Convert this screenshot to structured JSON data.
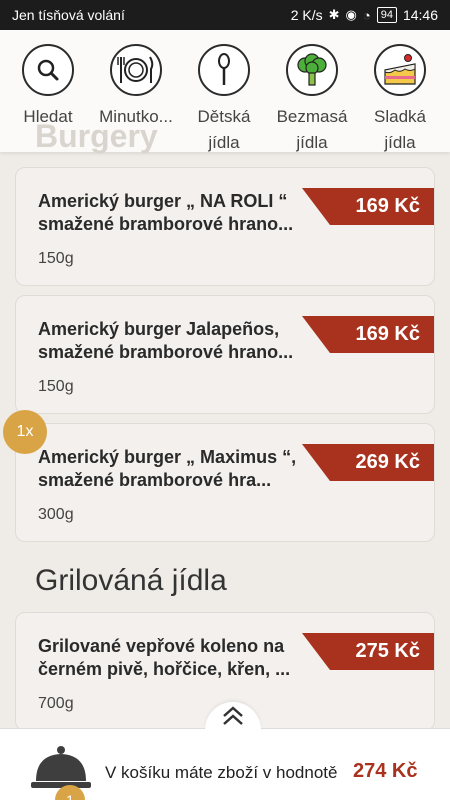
{
  "status_bar": {
    "carrier": "Jen tísňová volání",
    "speed": "2 K/s",
    "battery": "94",
    "time": "14:46"
  },
  "ghost_title": "Burgery",
  "categories": [
    {
      "label": "Hledat",
      "icon": "search-icon"
    },
    {
      "label": "Minutko...",
      "icon": "plate-cutlery-icon"
    },
    {
      "label": "Dětská\njídla",
      "icon": "spoon-icon"
    },
    {
      "label": "Bezmasá\njídla",
      "icon": "broccoli-icon"
    },
    {
      "label": "Sladká\njídla",
      "icon": "cake-icon"
    }
  ],
  "items": [
    {
      "name": "Americký burger „ NA ROLI “ smažené bramborové hrano...",
      "weight": "150g",
      "price": "169 Kč"
    },
    {
      "name": "Americký burger Jalapeños, smažené bramborové hrano...",
      "weight": "150g",
      "price": "169 Kč"
    },
    {
      "name": "Americký burger „ Maximus “, smažené bramborové hra...",
      "weight": "300g",
      "price": "269 Kč",
      "quantity": "1x"
    },
    {
      "name": "Grilované vepřové koleno na černém pivě, hořčice, křen, ...",
      "weight": "700g",
      "price": "275 Kč"
    }
  ],
  "section_grill": "Grilováná jídla",
  "cart": {
    "text": "V košíku máte zboží v hodnotě",
    "total": "274 Kč",
    "count": "1"
  },
  "colors": {
    "accent": "#a8321e",
    "badge": "#d8a446"
  }
}
